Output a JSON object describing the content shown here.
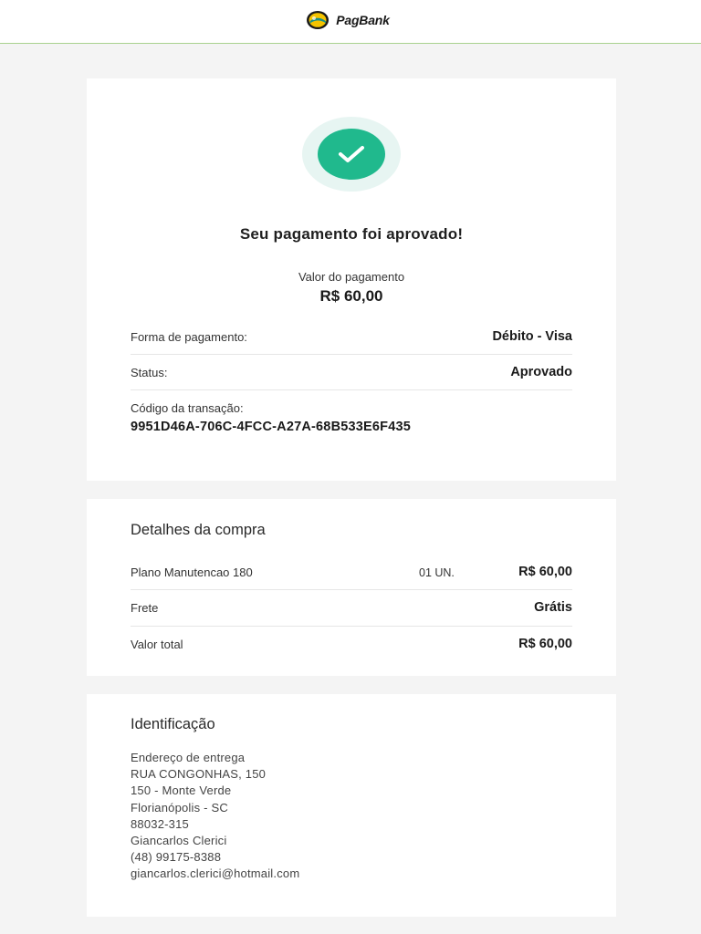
{
  "header": {
    "brand": "PagBank"
  },
  "payment": {
    "title": "Seu pagamento foi aprovado!",
    "amount_label": "Valor do pagamento",
    "amount": "R$ 60,00",
    "method_label": "Forma de pagamento:",
    "method_value": "Débito - Visa",
    "status_label": "Status:",
    "status_value": "Aprovado",
    "code_label": "Código da transação:",
    "code_value": "9951D46A-706C-4FCC-A27A-68B533E6F435"
  },
  "details": {
    "title": "Detalhes da compra",
    "item_name": "Plano Manutencao 180",
    "item_qty": "01 UN.",
    "item_price": "R$ 60,00",
    "shipping_label": "Frete",
    "shipping_value": "Grátis",
    "total_label": "Valor total",
    "total_value": "R$ 60,00"
  },
  "identification": {
    "title": "Identificação",
    "lines": [
      "Endereço de entrega",
      "RUA CONGONHAS, 150",
      "150 - Monte Verde",
      "Florianópolis - SC",
      "88032-315",
      "Giancarlos Clerici",
      "(48) 99175-8388",
      "giancarlos.clerici@hotmail.com"
    ]
  },
  "colors": {
    "success_green": "#20b98d",
    "success_halo": "#e7f5f2",
    "header_line": "#a9d18e",
    "logo_yellow": "#f5c400",
    "logo_teal": "#1a8f85"
  }
}
